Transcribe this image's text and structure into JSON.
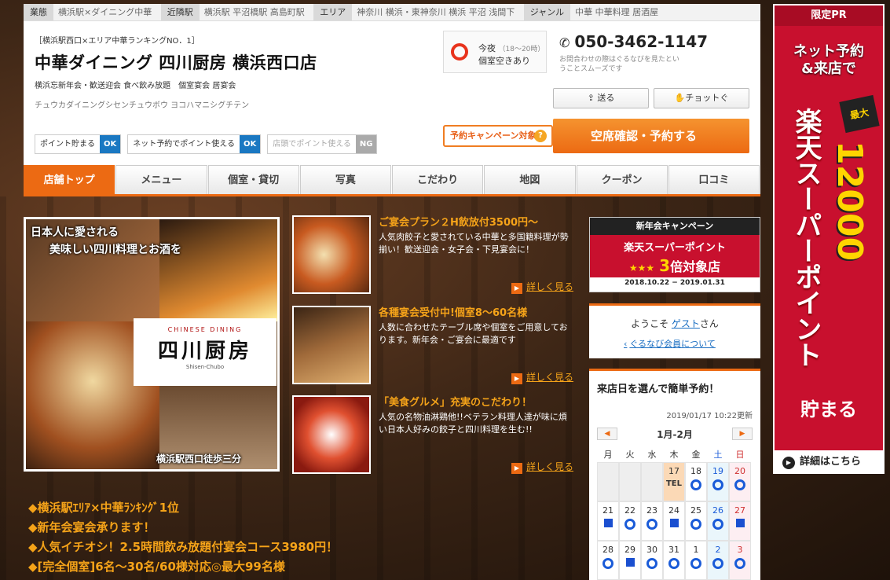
{
  "infobar": {
    "items": [
      {
        "label": "業態",
        "value": "横浜駅×ダイニング中華"
      },
      {
        "label": "近隣駅",
        "value": "横浜駅 平沼橋駅 高島町駅"
      },
      {
        "label": "エリア",
        "value": "神奈川 横浜・東神奈川 横浜 平沼 浅間下"
      },
      {
        "label": "ジャンル",
        "value": "中華 中華料理 居酒屋"
      }
    ]
  },
  "header": {
    "tagline": "［横浜駅西口×エリア中華ランキングNO．1］",
    "shop_name": "中華ダイニング 四川厨房 横浜西口店",
    "subcats": "横浜忘新年会・歓送迎会 食べ飲み放題　個室宴会 居宴会",
    "kana": "チュウカダイニングシセンチュウボウ ヨコハマニシグチテン"
  },
  "points": [
    {
      "label": "ポイント貯まる",
      "status": "OK"
    },
    {
      "label": "ネット予約でポイント使える",
      "status": "OK"
    },
    {
      "label": "店頭でポイント使える",
      "status": "NG"
    }
  ],
  "seat": {
    "line1": "今夜",
    "time": "（18〜20時）",
    "line2": "個室空きあり"
  },
  "phone": {
    "number": "050-3462-1147",
    "note": "お問合わせの際はぐるなびを見たということスムーズです"
  },
  "actions": {
    "send": "送る",
    "chotto": "チョットぐ",
    "campaign": "予約キャンペーン対象店",
    "help": "?",
    "reserve": "空席確認・予約する"
  },
  "tabs": [
    "店舗トップ",
    "メニュー",
    "個室・貸切",
    "写真",
    "こだわり",
    "地図",
    "クーポン",
    "口コミ"
  ],
  "hero": {
    "cap1": "日本人に愛される",
    "cap2": "美味しい四川料理とお酒を",
    "logo_en": "CHINESE DINING",
    "logo_jp": "四川厨房",
    "logo_romaji": "Shisen-Chubo",
    "cap3": "横浜駅西口徒歩三分"
  },
  "promos": [
    {
      "title": "ご宴会プラン２H飲放付3500円〜",
      "text": "人気肉餃子と愛されている中華と多国籍料理が勢揃い！歓送迎会・女子会・下見宴会に！",
      "more": "詳しく見る"
    },
    {
      "title": "各種宴会受付中!個室8〜60名様",
      "text": "人数に合わせたテーブル席や個室をご用意しております。新年会・ご宴会に最適です",
      "more": "詳しく見る"
    },
    {
      "title": "「美食グルメ」充実のこだわり！",
      "text": "人気の名物油淋鶏他!!ベテラン料理人達が味に煩い日本人好みの餃子と四川料理を生む!!",
      "more": "詳しく見る"
    }
  ],
  "notes": [
    "◆横浜駅ｴﾘｱ×中華ﾗﾝｷﾝｸﾞ1位",
    "◆新年会宴会承ります！",
    "◆人気イチオシ！2.5時間飲み放題付宴会コース3980円！",
    "◆[完全個室]6名〜30名/60様対応◎最大99名様"
  ],
  "banner": {
    "head": "新年会キャンペーン",
    "line1": "楽天スーパーポイント",
    "stars": "★★★",
    "mult": "3",
    "suffix": "倍対象店",
    "dates": "2018.10.22 − 2019.01.31"
  },
  "welcome": {
    "prefix": "ようこそ ",
    "guest": "ゲスト",
    "suffix": "さん",
    "link": "ぐるなび会員について"
  },
  "calendar": {
    "title": "来店日を選んで簡単予約！",
    "updated": "2019/01/17 10:22更新",
    "month": "1月-2月",
    "prev": "◀",
    "next": "▶",
    "dows": [
      "月",
      "火",
      "水",
      "木",
      "金",
      "土",
      "日"
    ],
    "rows": [
      [
        {
          "d": ""
        },
        {
          "d": ""
        },
        {
          "d": ""
        },
        {
          "d": "17",
          "m": "TEL"
        },
        {
          "d": "18",
          "m": "o"
        },
        {
          "d": "19",
          "m": "o"
        },
        {
          "d": "20",
          "m": "o"
        }
      ],
      [
        {
          "d": "21",
          "m": "s"
        },
        {
          "d": "22",
          "m": "o"
        },
        {
          "d": "23",
          "m": "o"
        },
        {
          "d": "24",
          "m": "s"
        },
        {
          "d": "25",
          "m": "o"
        },
        {
          "d": "26",
          "m": "o"
        },
        {
          "d": "27",
          "m": "s"
        }
      ],
      [
        {
          "d": "28",
          "m": "o"
        },
        {
          "d": "29",
          "m": "s"
        },
        {
          "d": "30",
          "m": "o"
        },
        {
          "d": "31",
          "m": "o"
        },
        {
          "d": "1",
          "m": "o"
        },
        {
          "d": "2",
          "m": "o"
        },
        {
          "d": "3",
          "m": "o"
        }
      ]
    ]
  },
  "ad": {
    "head": "限定PR",
    "line1": "ネット予約",
    "line2": "&来店で",
    "max": "最大",
    "brand": "楽天スーパーポイント",
    "amount": "12000",
    "unit": "貯まる",
    "details": "詳細はこちら"
  }
}
